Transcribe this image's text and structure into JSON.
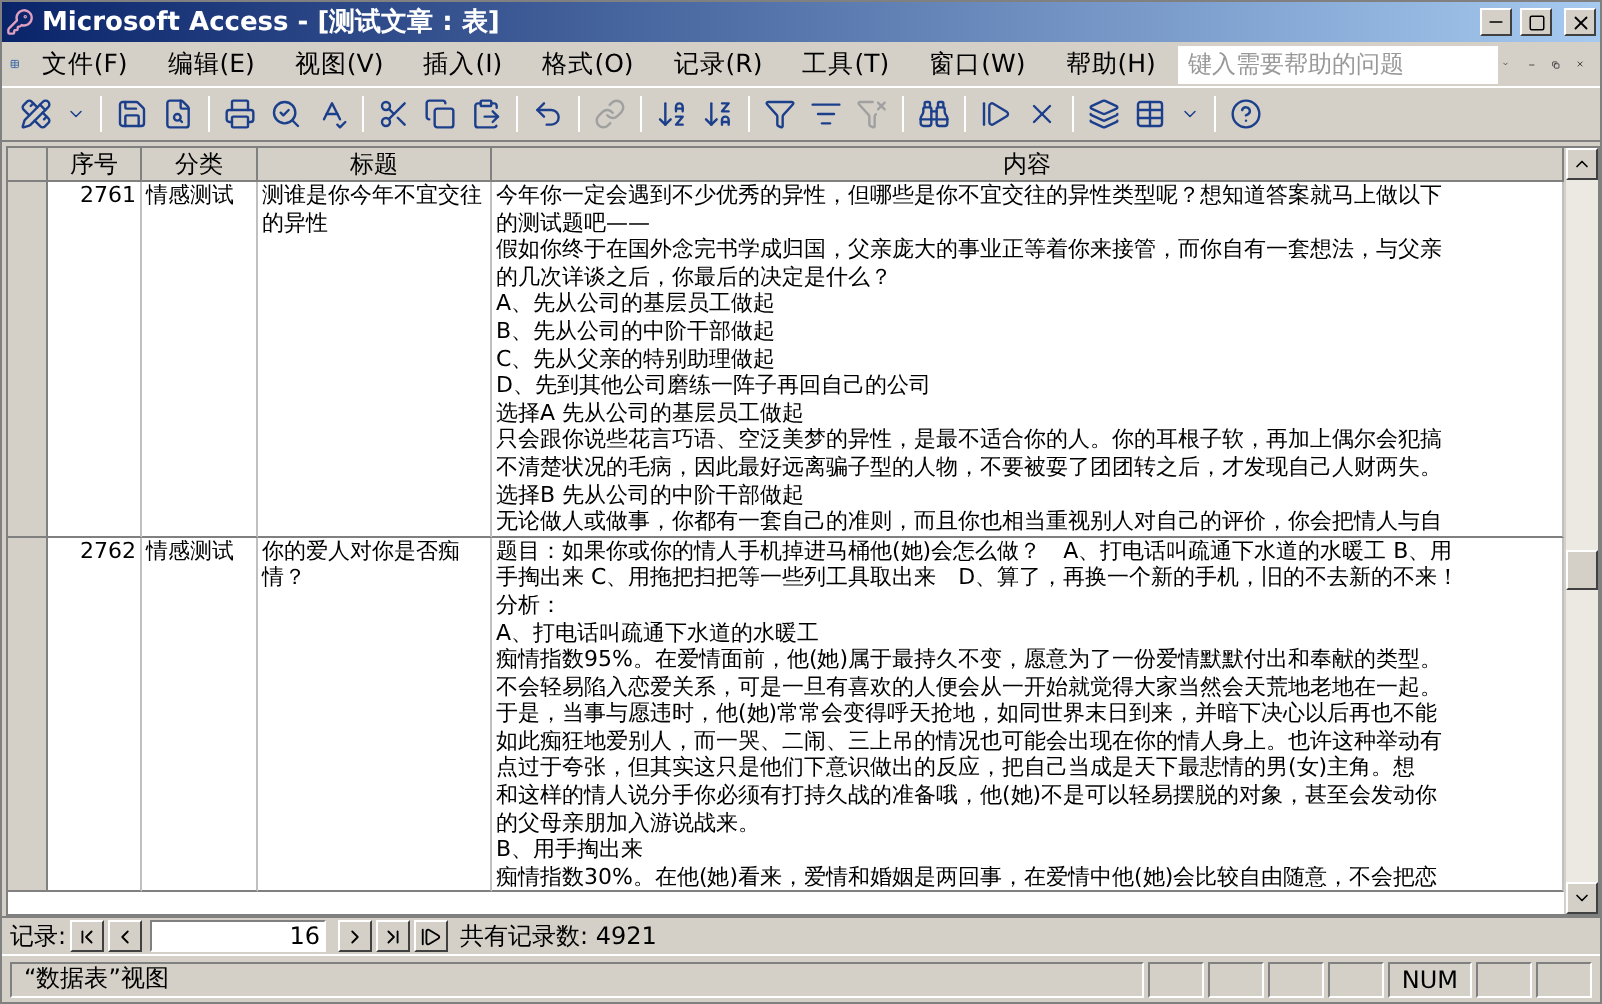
{
  "window": {
    "title": "Microsoft Access - [测试文章 : 表]"
  },
  "menu": [
    "文件(F)",
    "编辑(E)",
    "视图(V)",
    "插入(I)",
    "格式(O)",
    "记录(R)",
    "工具(T)",
    "窗口(W)",
    "帮助(H)"
  ],
  "help_box": {
    "placeholder": "键入需要帮助的问题"
  },
  "table": {
    "columns": [
      "序号",
      "分类",
      "标题",
      "内容"
    ],
    "rows": [
      {
        "number": "2761",
        "category": "情感测试",
        "title": "测谁是你今年不宜交往的异性",
        "content": [
          "今年你一定会遇到不少优秀的异性，但哪些是你不宜交往的异性类型呢？想知道答案就马上做以下",
          "的测试题吧——",
          "假如你终于在国外念完书学成归国，父亲庞大的事业正等着你来接管，而你自有一套想法，与父亲",
          "的几次详谈之后，你最后的决定是什么？",
          "A、先从公司的基层员工做起",
          "B、先从公司的中阶干部做起",
          "C、先从父亲的特别助理做起",
          "D、先到其他公司磨练一阵子再回自己的公司",
          "选择A 先从公司的基层员工做起",
          "只会跟你说些花言巧语、空泛美梦的异性，是最不适合你的人。你的耳根子软，再加上偶尔会犯搞",
          "不清楚状况的毛病，因此最好远离骗子型的人物，不要被耍了团团转之后，才发现自己人财两失。",
          "选择B 先从公司的中阶干部做起",
          "无论做人或做事，你都有一套自己的准则，而且你也相当重视别人对自己的评价，你会把情人与自"
        ]
      },
      {
        "number": "2762",
        "category": "情感测试",
        "title": "你的爱人对你是否痴情？",
        "content": [
          "题目：如果你或你的情人手机掉进马桶他(她)会怎么做？　A、打电话叫疏通下水道的水暖工 B、用",
          "手掏出来 C、用拖把扫把等一些列工具取出来　D、算了，再换一个新的手机，旧的不去新的不来！",
          "分析：",
          "A、打电话叫疏通下水道的水暖工",
          "痴情指数95%。在爱情面前，他(她)属于最持久不变，愿意为了一份爱情默默付出和奉献的类型。",
          "不会轻易陷入恋爱关系，可是一旦有喜欢的人便会从一开始就觉得大家当然会天荒地老地在一起。",
          "于是，当事与愿违时，他(她)常常会变得呼天抢地，如同世界末日到来，并暗下决心以后再也不能",
          "如此痴狂地爱别人，而一哭、二闹、三上吊的情况也可能会出现在你的情人身上。也许这种举动有",
          "点过于夸张，但其实这只是他们下意识做出的反应，把自己当成是天下最悲情的男(女)主角。想",
          "和这样的情人说分手你必须有打持久战的准备哦，他(她)不是可以轻易摆脱的对象，甚至会发动你",
          "的父母亲朋加入游说战来。",
          "B、用手掏出来",
          "痴情指数30%。在他(她)看来，爱情和婚姻是两回事，在爱情中他(她)会比较自由随意，不会把恋"
        ]
      }
    ]
  },
  "record_nav": {
    "label": "记录:",
    "current": "16",
    "total": "共有记录数: 4921"
  },
  "status_bar": {
    "view": "“数据表”视图",
    "num": "NUM"
  }
}
